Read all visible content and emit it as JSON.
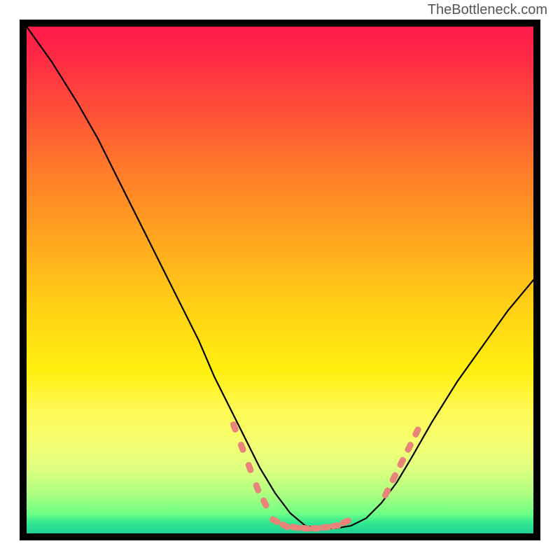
{
  "watermark": "TheBottleneck.com",
  "chart_data": {
    "type": "line",
    "title": "",
    "xlabel": "",
    "ylabel": "",
    "xlim": [
      0,
      100
    ],
    "ylim": [
      0,
      100
    ],
    "gradient_stops": [
      {
        "pos": 0,
        "color": "#ff1a4a"
      },
      {
        "pos": 15,
        "color": "#ff4a3a"
      },
      {
        "pos": 40,
        "color": "#ffa020"
      },
      {
        "pos": 68,
        "color": "#fff010"
      },
      {
        "pos": 92,
        "color": "#b0ff80"
      },
      {
        "pos": 100,
        "color": "#20d095"
      }
    ],
    "series": [
      {
        "name": "bottleneck-curve-black",
        "stroke": "#000000",
        "x": [
          0,
          5,
          10,
          14,
          18,
          22,
          26,
          30,
          34,
          37,
          40,
          43,
          46,
          49,
          52,
          55,
          58,
          61,
          64,
          67,
          70,
          73,
          76,
          80,
          85,
          90,
          95,
          100
        ],
        "y": [
          100,
          93,
          85,
          78,
          70,
          62,
          54,
          46,
          38,
          31,
          25,
          19,
          13,
          8,
          4,
          1.5,
          1,
          1,
          1.5,
          3,
          6,
          10,
          15,
          22,
          30,
          37,
          44,
          50
        ]
      },
      {
        "name": "scatter-left-salmon",
        "stroke": "#e8847a",
        "type_hint": "dashed-blob",
        "x": [
          41,
          42.5,
          44,
          45.5,
          47
        ],
        "y": [
          21,
          17,
          13,
          9,
          6
        ]
      },
      {
        "name": "scatter-bottom-salmon",
        "stroke": "#e8847a",
        "type_hint": "dashed-blob",
        "x": [
          49,
          51,
          53,
          55,
          57,
          59,
          61,
          63
        ],
        "y": [
          2.5,
          1.5,
          1.2,
          1,
          1,
          1.2,
          1.5,
          2.3
        ]
      },
      {
        "name": "scatter-right-salmon",
        "stroke": "#e8847a",
        "type_hint": "dashed-blob",
        "x": [
          71,
          72.5,
          74,
          75.5,
          77
        ],
        "y": [
          8,
          11,
          14,
          17,
          20
        ]
      }
    ]
  }
}
